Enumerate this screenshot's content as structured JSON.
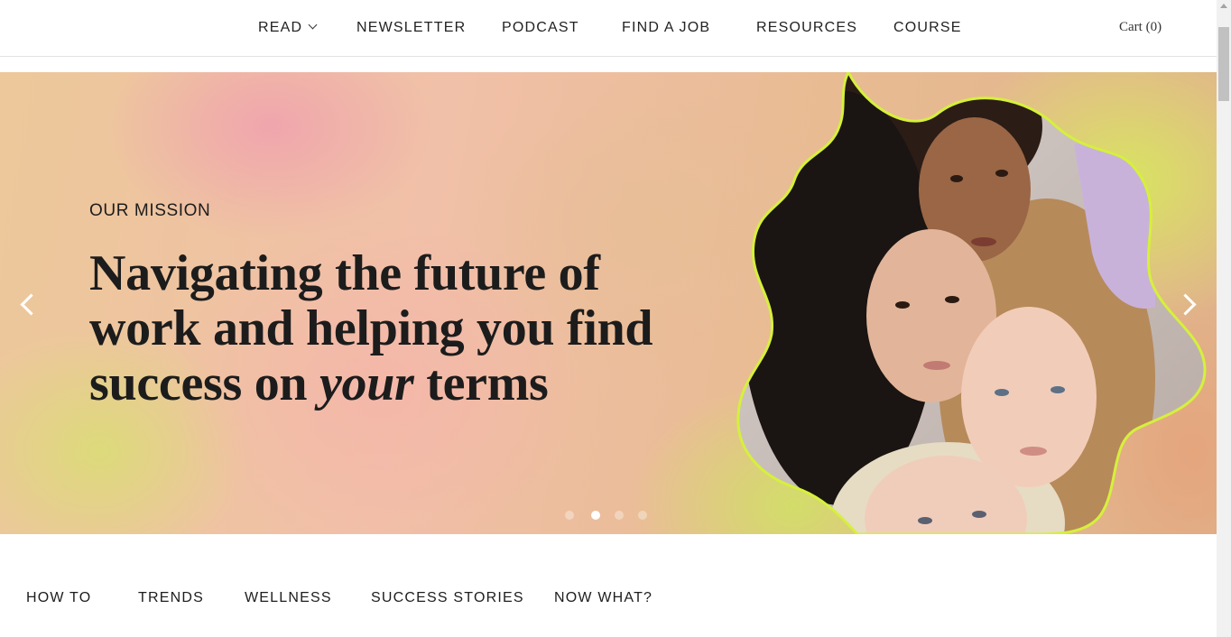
{
  "nav": {
    "items": [
      {
        "label": "READ"
      },
      {
        "label": "NEWSLETTER"
      },
      {
        "label": "PODCAST"
      },
      {
        "label": "FIND A JOB"
      },
      {
        "label": "RESOURCES"
      },
      {
        "label": "COURSE"
      }
    ],
    "cart_label": "Cart (0)"
  },
  "hero": {
    "eyebrow": "OUR MISSION",
    "headline_part1": "Navigating the future of work and helping you find success on ",
    "headline_emphasis": "your",
    "headline_part2": " terms",
    "slides": {
      "total": 4,
      "active_index": 1
    }
  },
  "categories": [
    {
      "label": "HOW TO"
    },
    {
      "label": "TRENDS"
    },
    {
      "label": "WELLNESS"
    },
    {
      "label": "SUCCESS STORIES"
    },
    {
      "label": "NOW WHAT?"
    }
  ],
  "colors": {
    "accent_lime": "#d6f03c",
    "text": "#1c1c1c"
  }
}
